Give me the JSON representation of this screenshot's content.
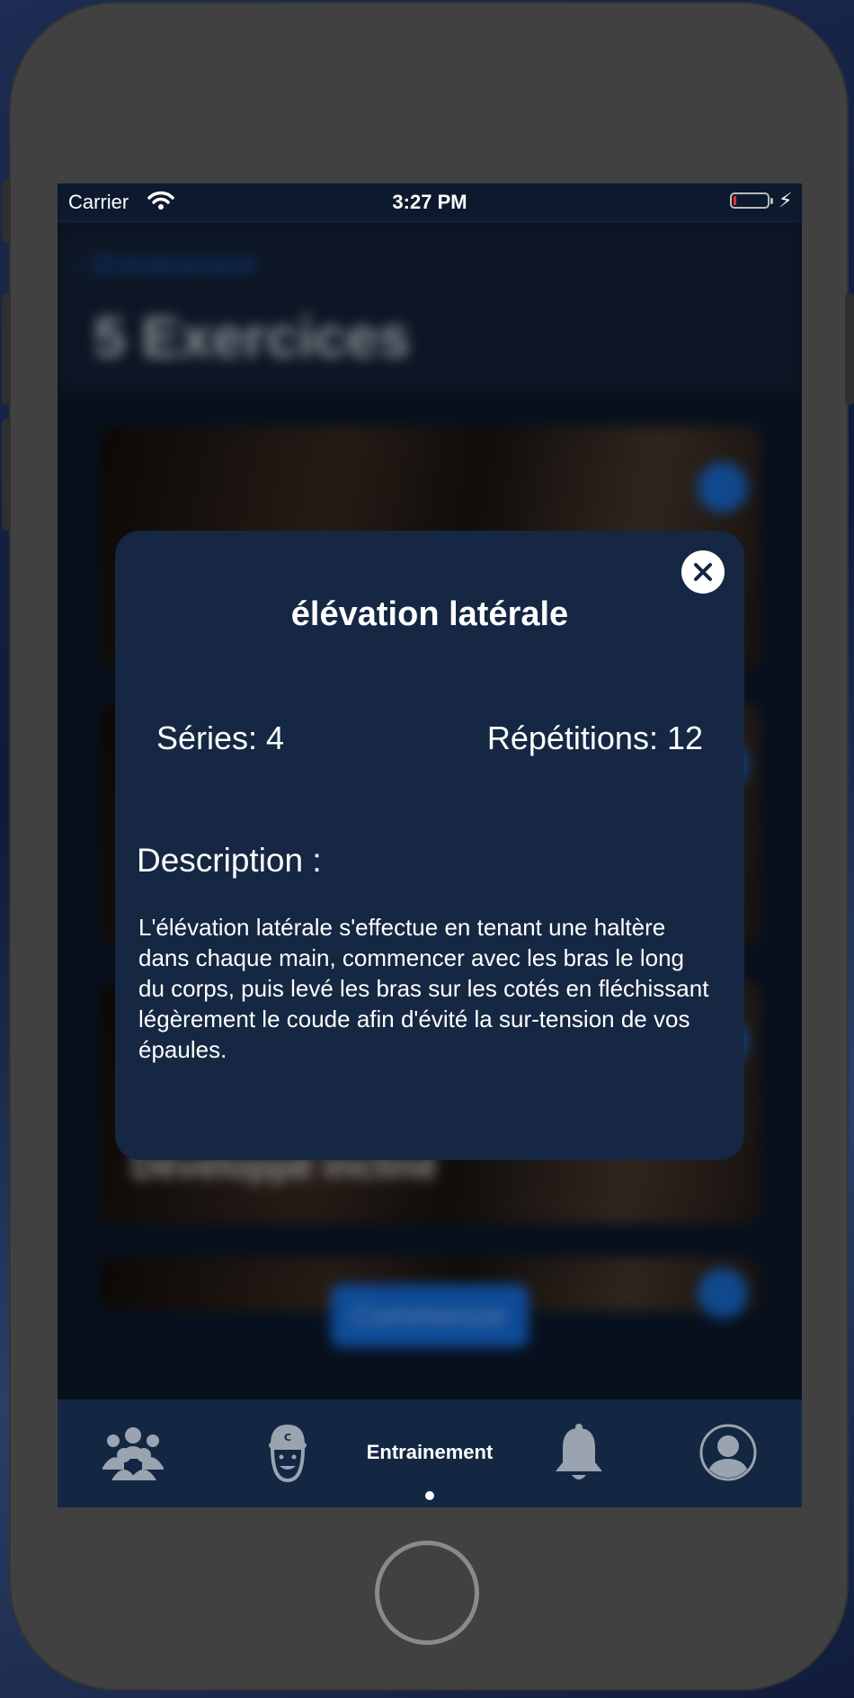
{
  "status_bar": {
    "carrier": "Carrier",
    "time": "3:27 PM",
    "battery_level": 0.05
  },
  "background_screen": {
    "back_label": "Entrainement",
    "title": "5 Exercices",
    "cards": [
      {
        "label": ""
      },
      {
        "label": ""
      },
      {
        "label": "Développé incliné"
      },
      {
        "label": ""
      }
    ],
    "start_button": "Commencer"
  },
  "modal": {
    "title": "élévation latérale",
    "series": "Séries: 4",
    "repetitions": "Répétitions: 12",
    "description_heading": "Description :",
    "description_body": "L'élévation latérale s'effectue en tenant une haltère dans chaque main, commencer avec les bras le long du corps, puis levé les bras sur les cotés en fléchissant légèrement le coude afin d'évité la sur-tension de vos épaules."
  },
  "tab_bar": {
    "active_label": "Entrainement",
    "items": [
      {
        "icon": "group-icon"
      },
      {
        "icon": "coach-icon"
      },
      {
        "label": "Entrainement"
      },
      {
        "icon": "bell-icon"
      },
      {
        "icon": "profile-icon"
      }
    ]
  },
  "colors": {
    "modal_bg": "#152742",
    "accent": "#1673e8",
    "tabbar_bg": "#132742"
  }
}
